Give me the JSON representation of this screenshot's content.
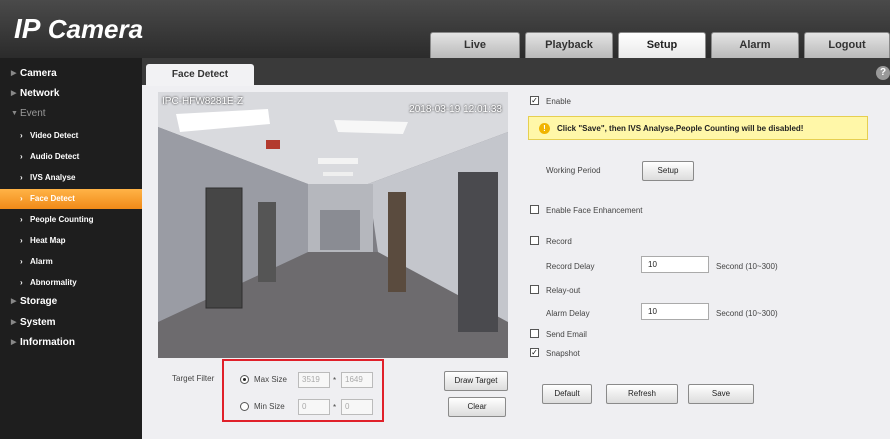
{
  "header": {
    "logo_ip": "IP",
    "logo_camera": "Camera",
    "tabs": [
      {
        "label": "Live"
      },
      {
        "label": "Playback"
      },
      {
        "label": "Setup"
      },
      {
        "label": "Alarm"
      },
      {
        "label": "Logout"
      }
    ],
    "active_tab": "Setup"
  },
  "sidebar": {
    "items": [
      {
        "label": "Camera"
      },
      {
        "label": "Network"
      },
      {
        "label": "Event"
      },
      {
        "label": "Storage"
      },
      {
        "label": "System"
      },
      {
        "label": "Information"
      }
    ],
    "event_children": [
      {
        "label": "Video Detect"
      },
      {
        "label": "Audio Detect"
      },
      {
        "label": "IVS Analyse"
      },
      {
        "label": "Face Detect"
      },
      {
        "label": "People Counting"
      },
      {
        "label": "Heat Map"
      },
      {
        "label": "Alarm"
      },
      {
        "label": "Abnormality"
      }
    ],
    "active_child": "Face Detect"
  },
  "page": {
    "tab_label": "Face Detect",
    "help": "?"
  },
  "video": {
    "camera_name": "IPC-HFW8281E-Z",
    "timestamp": "2018-03-19 12:01:33"
  },
  "target_filter": {
    "label": "Target Filter",
    "max_size_label": "Max Size",
    "max_w": "3519",
    "max_h": "1649",
    "min_size_label": "Min Size",
    "min_w": "0",
    "min_h": "0",
    "separator": "*",
    "draw_target": "Draw Target",
    "clear": "Clear"
  },
  "settings": {
    "enable_label": "Enable",
    "enable_checked": true,
    "warning": "Click \"Save\", then IVS Analyse,People Counting will be disabled!",
    "working_period_label": "Working Period",
    "setup_button": "Setup",
    "face_enhancement_label": "Enable Face Enhancement",
    "record_label": "Record",
    "record_delay_label": "Record Delay",
    "record_delay_value": "10",
    "record_delay_unit": "Second (10~300)",
    "relay_out_label": "Relay-out",
    "alarm_delay_label": "Alarm Delay",
    "alarm_delay_value": "10",
    "alarm_delay_unit": "Second (10~300)",
    "send_email_label": "Send Email",
    "snapshot_label": "Snapshot",
    "snapshot_checked": true,
    "check_mark": "✓"
  },
  "actions": {
    "default": "Default",
    "refresh": "Refresh",
    "save": "Save"
  }
}
